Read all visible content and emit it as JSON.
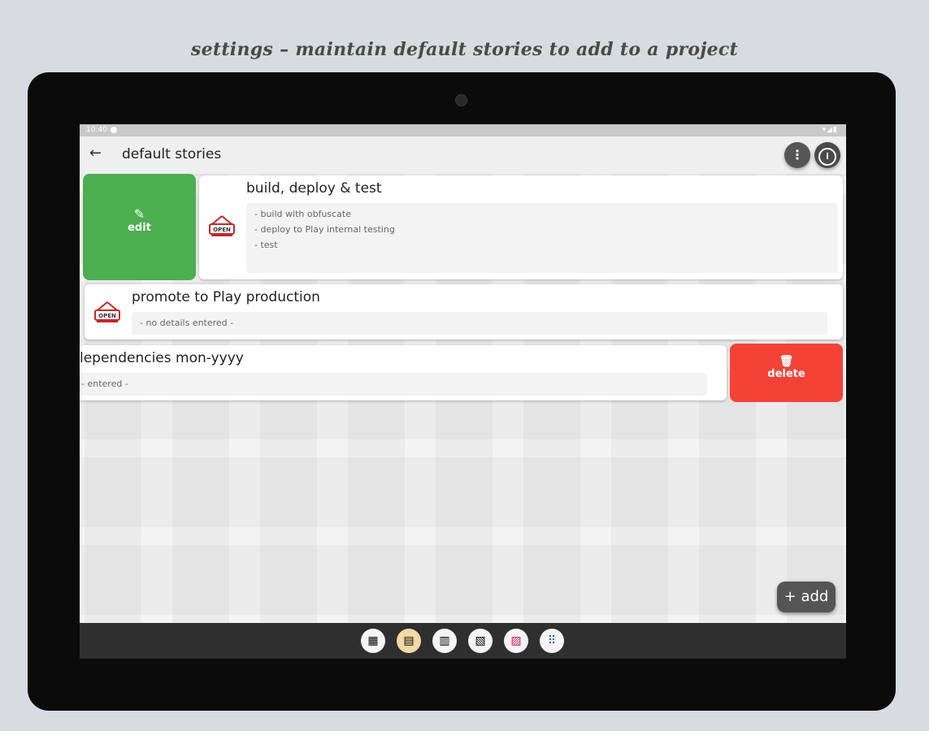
{
  "caption": "settings – maintain default stories to add to a project",
  "status": {
    "time": "10:40"
  },
  "toolbar": {
    "back": "←",
    "title": "default stories",
    "more": "⋮",
    "info": "i"
  },
  "stories": [
    {
      "title": "build, deploy & test",
      "details": [
        "- build with obfuscate",
        "- deploy to Play internal testing",
        "- test"
      ]
    },
    {
      "title": "promote to Play production",
      "details": [
        "- no details entered -"
      ]
    },
    {
      "title": "lependencies mon-yyyy",
      "details": [
        "- entered -"
      ]
    }
  ],
  "actions": {
    "edit_label": "edit",
    "delete_label": "delete"
  },
  "sign_text": "OPEN",
  "add_label": "+ add",
  "dock_icons": [
    "app-icon-1",
    "app-icon-2",
    "app-icon-3",
    "app-icon-4",
    "app-icon-5",
    "app-drawer-icon"
  ],
  "colors": {
    "edit": "#4caf50",
    "delete": "#f44336",
    "button_dark": "#555555"
  }
}
